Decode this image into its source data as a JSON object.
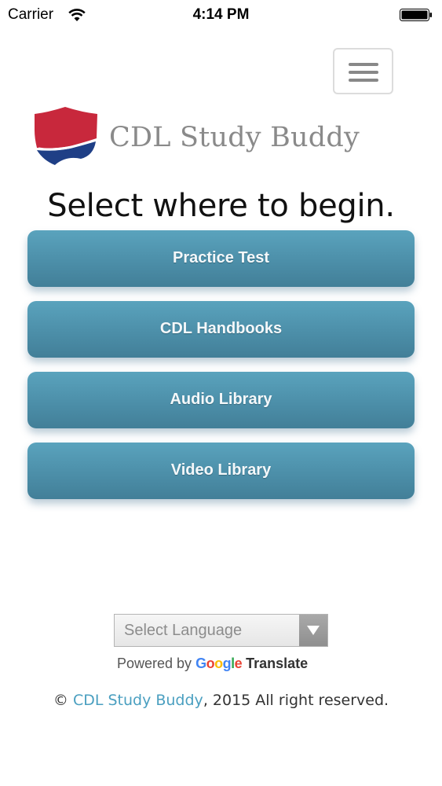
{
  "status_bar": {
    "carrier": "Carrier",
    "time": "4:14 PM",
    "icons": [
      "wifi-icon",
      "battery-icon"
    ]
  },
  "header": {
    "menu_icon": "hamburger-menu-icon",
    "logo_text": "CDL Study Buddy",
    "logo_colors": {
      "shield_red": "#c8283c",
      "shield_blue": "#1f3f86",
      "text_gray": "#8a8a8a"
    }
  },
  "main": {
    "headline": "Select where to begin.",
    "buttons": [
      {
        "label": "Practice Test"
      },
      {
        "label": "CDL Handbooks"
      },
      {
        "label": "Audio Library"
      },
      {
        "label": "Video Library"
      }
    ],
    "button_color": "#4b8da7"
  },
  "translate": {
    "select_label": "Select Language",
    "powered_by": "Powered by",
    "google_letters": [
      "G",
      "o",
      "o",
      "g",
      "l",
      "e"
    ],
    "translate_word": "Translate"
  },
  "footer": {
    "copyright_symbol": "©",
    "link_text": "CDL Study Buddy",
    "suffix": ", 2015 All right reserved.",
    "link_color": "#4a9fc0"
  }
}
